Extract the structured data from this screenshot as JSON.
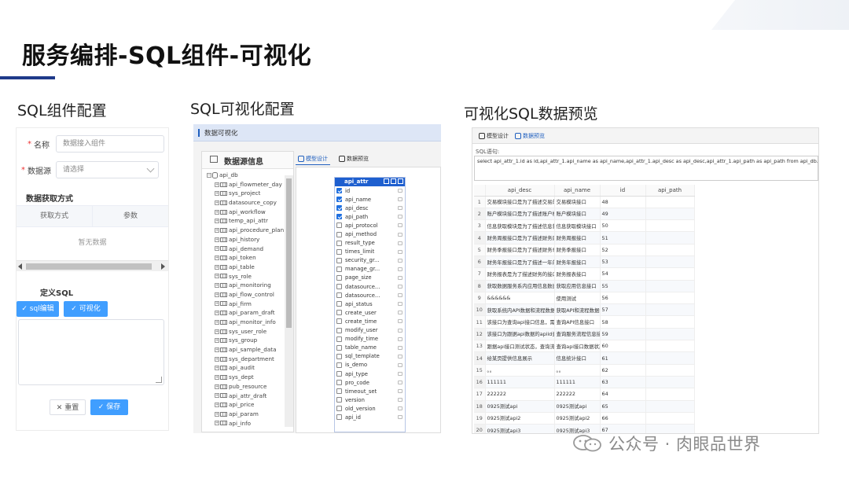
{
  "slide": {
    "title": "服务编排-SQL组件-可视化"
  },
  "sections": {
    "config": "SQL组件配置",
    "visual": "SQL可视化配置",
    "preview": "可视化SQL数据预览"
  },
  "panel1": {
    "name_label": "名称",
    "name_value": "数据接入组件",
    "datasource_label": "数据源",
    "datasource_placeholder": "请选择",
    "fetch_heading": "数据获取方式",
    "col_method": "获取方式",
    "col_param": "参数",
    "empty": "暂无数据",
    "sql_heading": "定义SQL",
    "btn_sql_edit": "sql编辑",
    "btn_visual": "可视化",
    "btn_reset": "重置",
    "btn_save": "保存"
  },
  "panel2": {
    "header": "数据可视化",
    "tree_title": "数据源信息",
    "root": "api_db",
    "tables": [
      "api_flowmeter_day",
      "sys_project",
      "datasource_copy",
      "api_workflow",
      "temp_api_attr",
      "api_procedure_plan",
      "api_history",
      "api_demand",
      "api_token",
      "api_table",
      "sys_role",
      "api_monitoring",
      "api_flow_control",
      "api_firm",
      "api_param_draft",
      "api_monitor_info",
      "sys_user_role",
      "sys_group",
      "api_sample_data",
      "sys_department",
      "api_audit",
      "sys_dept",
      "pub_resource",
      "api_attr_draft",
      "api_price",
      "api_param",
      "api_info"
    ],
    "tab_design": "模型设计",
    "tab_preview": "数据预览",
    "entity_name": "api_attr",
    "fields": [
      {
        "name": "id",
        "checked": true
      },
      {
        "name": "api_name",
        "checked": true
      },
      {
        "name": "api_desc",
        "checked": true
      },
      {
        "name": "api_path",
        "checked": true
      },
      {
        "name": "api_protocol",
        "checked": false
      },
      {
        "name": "api_method",
        "checked": false
      },
      {
        "name": "result_type",
        "checked": false
      },
      {
        "name": "times_limit",
        "checked": false
      },
      {
        "name": "security_gr...",
        "checked": false
      },
      {
        "name": "manage_gr...",
        "checked": false
      },
      {
        "name": "page_size",
        "checked": false
      },
      {
        "name": "datasource...",
        "checked": false
      },
      {
        "name": "datasource...",
        "checked": false
      },
      {
        "name": "api_status",
        "checked": false
      },
      {
        "name": "create_user",
        "checked": false
      },
      {
        "name": "create_time",
        "checked": false
      },
      {
        "name": "modify_user",
        "checked": false
      },
      {
        "name": "modify_time",
        "checked": false
      },
      {
        "name": "table_name",
        "checked": false
      },
      {
        "name": "sql_template",
        "checked": false
      },
      {
        "name": "is_demo",
        "checked": false
      },
      {
        "name": "api_type",
        "checked": false
      },
      {
        "name": "pro_code",
        "checked": false
      },
      {
        "name": "timeout_set",
        "checked": false
      },
      {
        "name": "version",
        "checked": false
      },
      {
        "name": "old_version",
        "checked": false
      },
      {
        "name": "api_id",
        "checked": false
      }
    ]
  },
  "panel3": {
    "tab_design": "模型设计",
    "tab_preview": "数据预览",
    "sql_label": "SQL语句:",
    "sql": "select api_attr_1.id as id,api_attr_1.api_name as api_name,api_attr_1.api_desc as api_desc,api_attr_1.api_path as api_path from api_db.api_attr as api_attr_1",
    "columns": [
      "api_desc",
      "api_name",
      "id",
      "api_path"
    ],
    "rows": [
      [
        "1",
        "交易模块接口是为了描述交易的",
        "交易模块接口",
        "48",
        ""
      ],
      [
        "2",
        "账户模块接口是为了描述账户模",
        "账户模块接口",
        "49",
        ""
      ],
      [
        "3",
        "信息获取模块是为了描述信息获",
        "信息获取模块接口",
        "50",
        ""
      ],
      [
        "4",
        "财务周报接口是为了描述财务周",
        "财务周报接口",
        "51",
        ""
      ],
      [
        "5",
        "财务季报接口是为了描述财务季",
        "财务季报接口",
        "52",
        ""
      ],
      [
        "6",
        "财务年报接口是为了描述一年的",
        "财务年报接口",
        "53",
        ""
      ],
      [
        "7",
        "财务报表是为了描述财务的接口",
        "财务报表接口",
        "54",
        ""
      ],
      [
        "8",
        "获取数据服务系内应用信息数据",
        "获取应用信息接口",
        "55",
        ""
      ],
      [
        "9",
        "&&&&&&",
        "使用测试",
        "56",
        ""
      ],
      [
        "10",
        "获取系统内API数据和流程数据结",
        "获取API和流程数据接",
        "57",
        ""
      ],
      [
        "11",
        "该接口为查询api接口信息，需要",
        "查询API信息接口",
        "58",
        ""
      ],
      [
        "12",
        "该接口为跟据api数据的apiid查",
        "查询服务流程信息接",
        "59",
        ""
      ],
      [
        "13",
        "跟据api接口测试状态，查询流程",
        "查询api接口数据状态",
        "60",
        ""
      ],
      [
        "14",
        "给某页提供信息展示",
        "信息统计接口",
        "61",
        ""
      ],
      [
        "15",
        "。。",
        "。。",
        "62",
        ""
      ],
      [
        "16",
        "111111",
        "111111",
        "63",
        ""
      ],
      [
        "17",
        "222222",
        "222222",
        "64",
        ""
      ],
      [
        "18",
        "0925测试api",
        "0925测试api",
        "65",
        ""
      ],
      [
        "19",
        "0925测试api2",
        "0925测试api2",
        "66",
        ""
      ],
      [
        "20",
        "0925测试api3",
        "0925测试api3",
        "67",
        ""
      ]
    ]
  },
  "watermark": {
    "text": "公众号 · 肉眼品世界"
  },
  "colors": {
    "accent": "#409eff",
    "title_rule": "#1f3a8a",
    "entity_header": "#1e5fcf"
  }
}
